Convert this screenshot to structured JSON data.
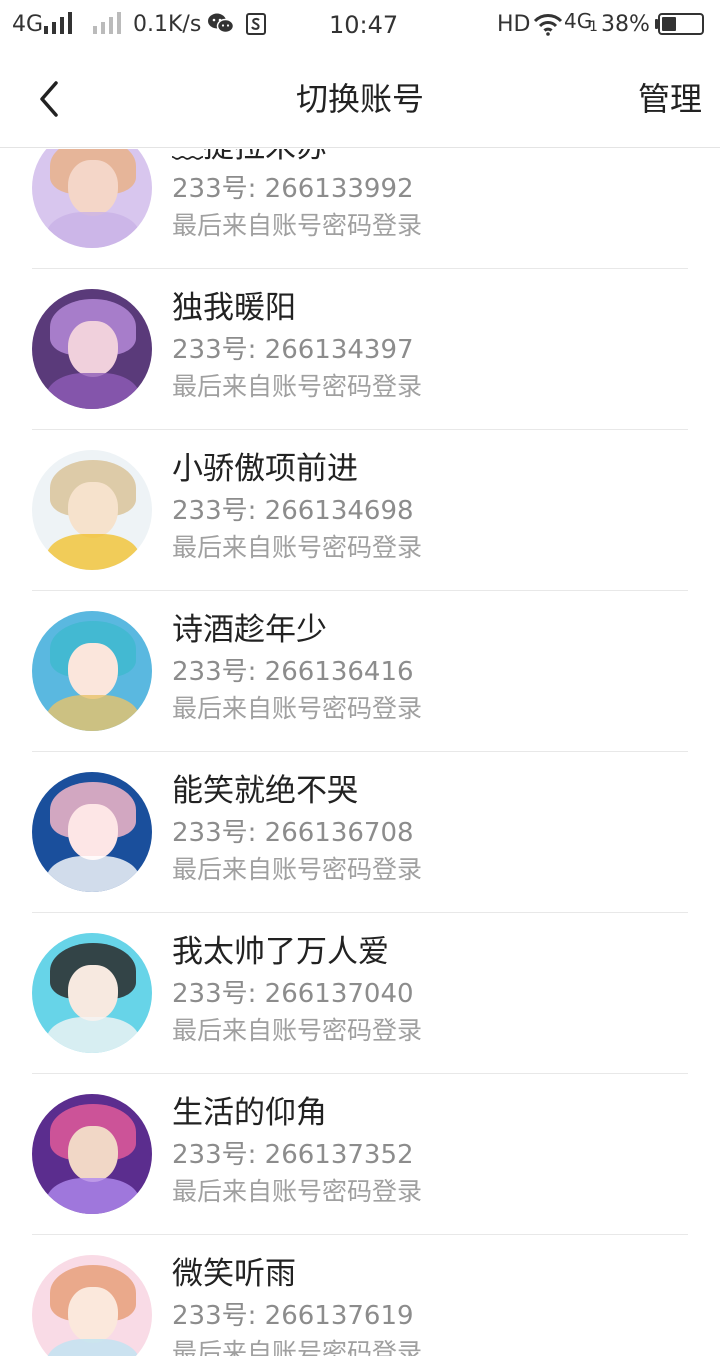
{
  "status_bar": {
    "network_type": "4G",
    "speed": "0.1K/s",
    "time": "10:47",
    "hd": "HD",
    "network_type_2": "4G",
    "sim_index": "1",
    "battery_text": "38%",
    "battery_level": 0.38,
    "icons": [
      "signal-icon",
      "signal-icon-dim",
      "wechat-icon",
      "app-s-icon",
      "wifi-icon",
      "battery-icon"
    ]
  },
  "header": {
    "back_icon": "chevron-left-icon",
    "title": "切换账号",
    "manage_label": "管理"
  },
  "accounts": [
    {
      "name": "﹏提拉米苏",
      "id_label": "233号:",
      "id": "266133992",
      "note": "最后来自账号密码登录",
      "avatar_colors": [
        "#d8c6ee",
        "#f4d6c8",
        "#e9b28a",
        "#c9b2e6"
      ]
    },
    {
      "name": "独我暖阳",
      "id_label": "233号:",
      "id": "266134397",
      "note": "最后来自账号密码登录",
      "avatar_colors": [
        "#5a3a7a",
        "#f0d0dc",
        "#b58ad8",
        "#8e5cb8"
      ]
    },
    {
      "name": "小骄傲项前进",
      "id_label": "233号:",
      "id": "266134698",
      "note": "最后来自账号密码登录",
      "avatar_colors": [
        "#eef3f6",
        "#f6e2cc",
        "#d9c39a",
        "#f1c232"
      ]
    },
    {
      "name": "诗酒趁年少",
      "id_label": "233号:",
      "id": "266136416",
      "note": "最后来自账号密码登录",
      "avatar_colors": [
        "#5ab8e0",
        "#fbe6dc",
        "#3fb8cf",
        "#e8c36a"
      ]
    },
    {
      "name": "能笑就绝不哭",
      "id_label": "233号:",
      "id": "266136708",
      "note": "最后来自账号密码登录",
      "avatar_colors": [
        "#1a4f9c",
        "#fde6e6",
        "#f3b6c8",
        "#ffffff"
      ]
    },
    {
      "name": "我太帅了万人爱",
      "id_label": "233号:",
      "id": "266137040",
      "note": "最后来自账号密码登录",
      "avatar_colors": [
        "#67d4e8",
        "#f7e9e0",
        "#2a2a2a",
        "#f4f4f4"
      ]
    },
    {
      "name": "生活的仰角",
      "id_label": "233号:",
      "id": "266137352",
      "note": "最后来自账号密码登录",
      "avatar_colors": [
        "#5b2d8e",
        "#f1d7c6",
        "#e05a9a",
        "#b08af0"
      ]
    },
    {
      "name": "微笑听雨",
      "id_label": "233号:",
      "id": "266137619",
      "note": "最后来自账号密码登录",
      "avatar_colors": [
        "#f9dbe6",
        "#fbe8dc",
        "#e7a07a",
        "#bfe3f2"
      ]
    }
  ]
}
